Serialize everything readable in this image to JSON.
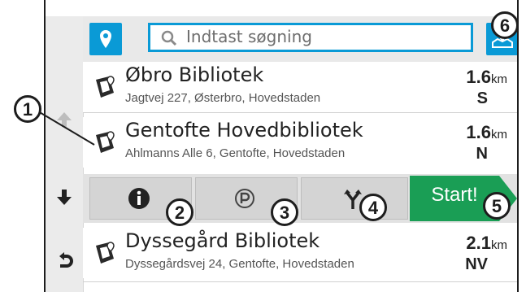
{
  "search": {
    "placeholder": "Indtast søgning"
  },
  "results": [
    {
      "name": "Øbro Bibliotek",
      "address": "Jagtvej 227, Østerbro, Hovedstaden",
      "distance": "1.6",
      "unit": "km",
      "direction": "S"
    },
    {
      "name": "Gentofte Hovedbibliotek",
      "address": "Ahlmanns Alle 6, Gentofte, Hovedstaden",
      "distance": "1.6",
      "unit": "km",
      "direction": "N"
    },
    {
      "name": "Dyssegård Bibliotek",
      "address": "Dyssegårdsvej 24, Gentofte, Hovedstaden",
      "distance": "2.1",
      "unit": "km",
      "direction": "NV"
    }
  ],
  "actions": {
    "info_icon": "info-icon",
    "parking_icon": "parking-icon",
    "route_icon": "route-fork-icon",
    "start_label": "Start!"
  },
  "callouts": [
    "1",
    "2",
    "3",
    "4",
    "5",
    "6"
  ],
  "colors": {
    "accent": "#0a9ad6",
    "start": "#1a9e55"
  }
}
